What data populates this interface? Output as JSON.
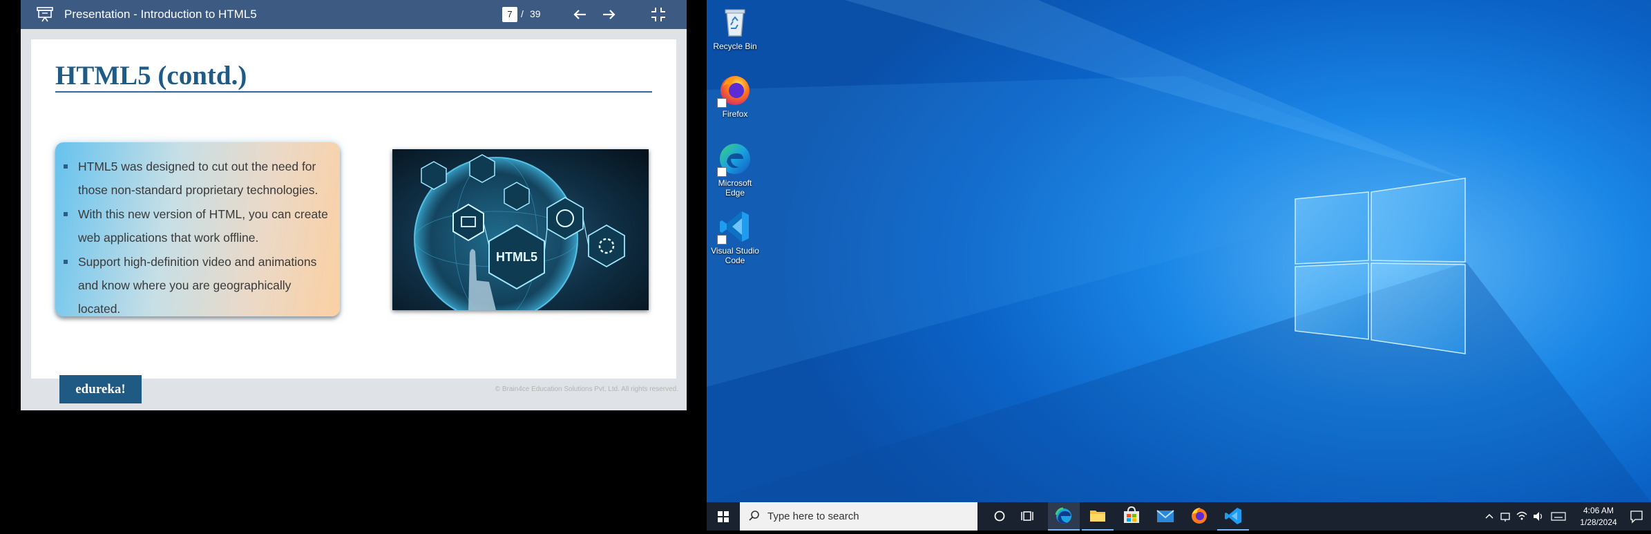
{
  "viewer": {
    "title": "Presentation - Introduction to HTML5",
    "current_page": "7",
    "page_separator": "/",
    "total_pages": "39",
    "icons": [
      "presentation-icon",
      "arrow-left-icon",
      "arrow-right-icon",
      "exit-fullscreen-icon"
    ]
  },
  "slide": {
    "title": "HTML5 (contd.)",
    "bullets": [
      "HTML5 was designed to cut out the need for those non-standard proprietary technologies.",
      "With this new version of HTML, you can create web applications that work offline.",
      "Support high-definition video and animations and know where you are geographically located."
    ],
    "image_text": "HTML5",
    "logo_text": "edureka!",
    "copyright": "© Brain4ce Education Solutions Pvt. Ltd. All rights reserved."
  },
  "desktop": {
    "icons": [
      {
        "label": "Recycle Bin",
        "icon": "recycle-bin-icon"
      },
      {
        "label": "Firefox",
        "icon": "firefox-icon"
      },
      {
        "label": "Microsoft Edge",
        "icon": "edge-icon"
      },
      {
        "label": "Visual Studio Code",
        "icon": "vscode-icon"
      }
    ]
  },
  "taskbar": {
    "search_placeholder": "Type here to search",
    "apps": [
      "cortana-icon",
      "task-view-icon",
      "edge-icon",
      "file-explorer-icon",
      "store-icon",
      "mail-icon",
      "firefox-icon",
      "vscode-icon"
    ],
    "tray": [
      "chevron-up-icon",
      "network-icon",
      "wifi-icon",
      "volume-icon",
      "keyboard-icon"
    ],
    "time": "4:06 AM",
    "date": "1/28/2024"
  },
  "colors": {
    "toolbar": "#3c5a82",
    "slide_title": "#1f5b87",
    "logo": "#1e5a84",
    "taskbar": "#1a2230",
    "desktop_blue": "#1a86e6"
  }
}
